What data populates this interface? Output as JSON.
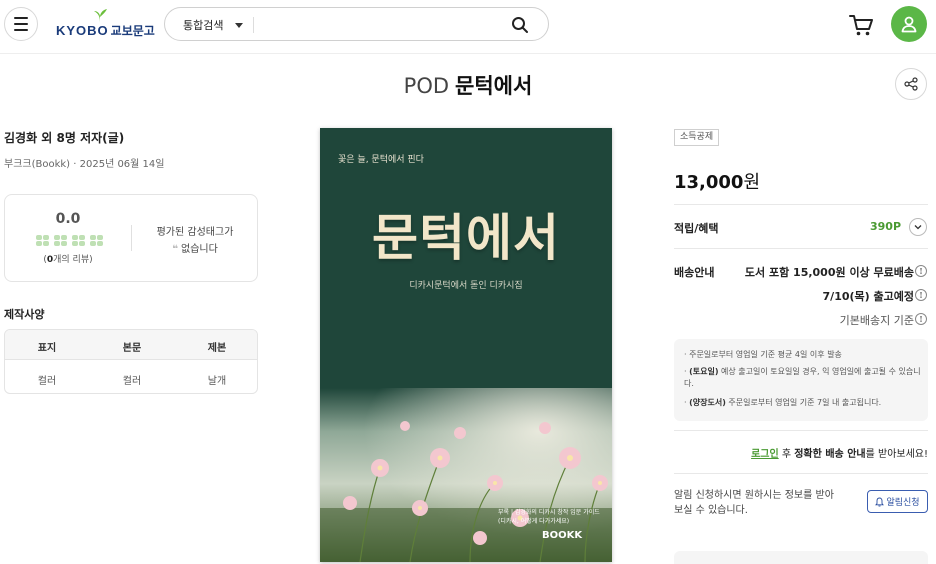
{
  "header": {
    "logo_en": "KYOBO",
    "logo_kr": "교보문고",
    "search_category": "통합검색",
    "search_placeholder": ""
  },
  "title": {
    "prefix": "POD",
    "main": "문턱에서"
  },
  "book": {
    "author": "김경화 외 8명 저자(글)",
    "publisher_date": "부크크(Bookk) · 2025년 06월 14일",
    "rating": "0.0",
    "review_count_num": "0",
    "review_count_suffix": "개의 리뷰)",
    "review_count_prefix": "(",
    "emotion_tag_label": "평가된 감성태그가",
    "emotion_tag_value": "없습니다",
    "emotion_quote": "❝"
  },
  "spec": {
    "title": "제작사양",
    "headers": [
      "표지",
      "본문",
      "제본"
    ],
    "values": [
      "컬러",
      "컬러",
      "날개"
    ]
  },
  "cover": {
    "tagline": "꽃은 늘, 문턱에서 핀다",
    "title": "문턱에서",
    "subtitle": "디카시문턱에서 돋인 디카시집",
    "note_line1": "부록 | 김경화의 디카시 창작 입문 가이드",
    "note_line2": "(디카시, 어떻게 다가가세요)",
    "brand": "BOOKK"
  },
  "purchase": {
    "badge": "소득공제",
    "price": "13,000",
    "price_unit": "원",
    "points_label": "적립/혜택",
    "points_value": "390P",
    "shipping_label": "배송안내",
    "shipping_line1": "도서 포함 15,000원 이상 무료배송",
    "shipping_line2": "7/10(목) 출고예정",
    "shipping_line3": "기본배송지 기준",
    "notice1": "· 주문일로부터 영업일 기준 평균 4일 이후 발송",
    "notice2_bold": "(토요일)",
    "notice2_rest": " 예상 출고일이 토요일일 경우, 익 영업일에 출고될 수 있습니다.",
    "notice3_bold": "(양장도서)",
    "notice3_rest": " 주문일로부터 영업일 기준 7일 내 출고됩니다.",
    "login_link": "로그인",
    "login_mid": " 후 ",
    "login_bold": "정확한 배송 안내",
    "login_tail": "를 받아보세요!",
    "alert_text": "알림 신청하시면 원하시는 정보를 받아 보실 수 있습니다.",
    "alert_button": "알림신청"
  },
  "colors": {
    "brand_green": "#5bb747",
    "cover_green": "#1f463a",
    "link_blue": "#2a4ea0"
  }
}
